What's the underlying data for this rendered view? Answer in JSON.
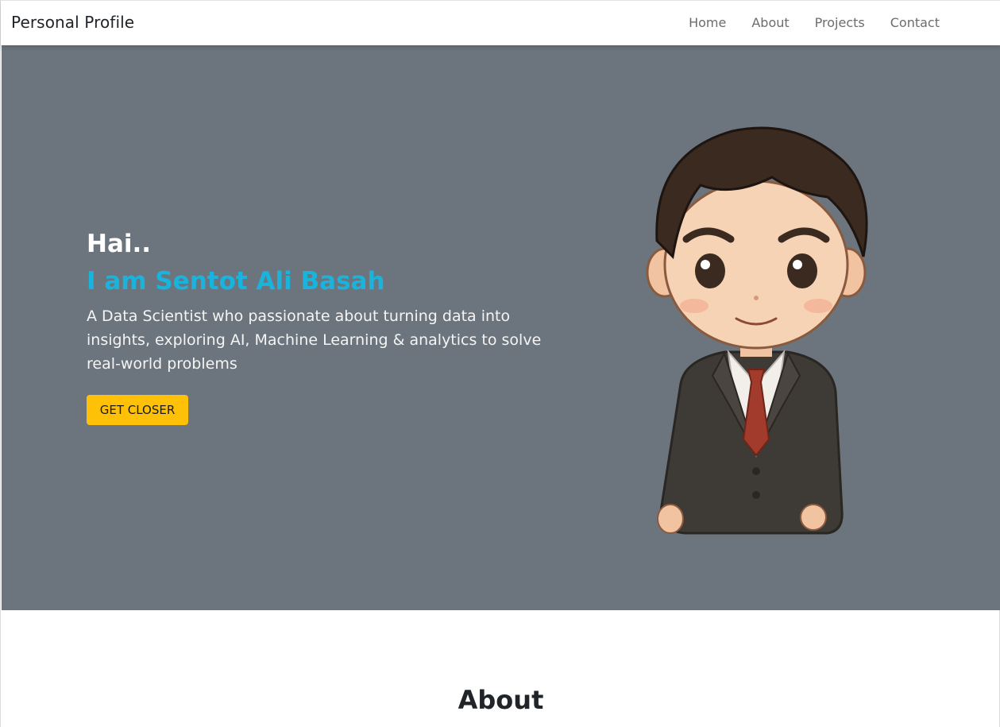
{
  "navbar": {
    "brand": "Personal Profile",
    "links": [
      "Home",
      "About",
      "Projects",
      "Contact"
    ]
  },
  "hero": {
    "greeting": "Hai..",
    "name": "I am Sentot Ali Basah",
    "description": "A Data Scientist who passionate about turning data into insights, exploring AI, Machine Learning & analytics to solve real-world problems",
    "cta_label": "GET CLOSER",
    "avatar_icon": "cartoon-avatar-illustration"
  },
  "about": {
    "title": "About"
  },
  "colors": {
    "hero_bg": "#6c757d",
    "accent_name": "#1ab3dc",
    "cta_bg": "#ffc107",
    "nav_text": "#6c6c6c"
  }
}
